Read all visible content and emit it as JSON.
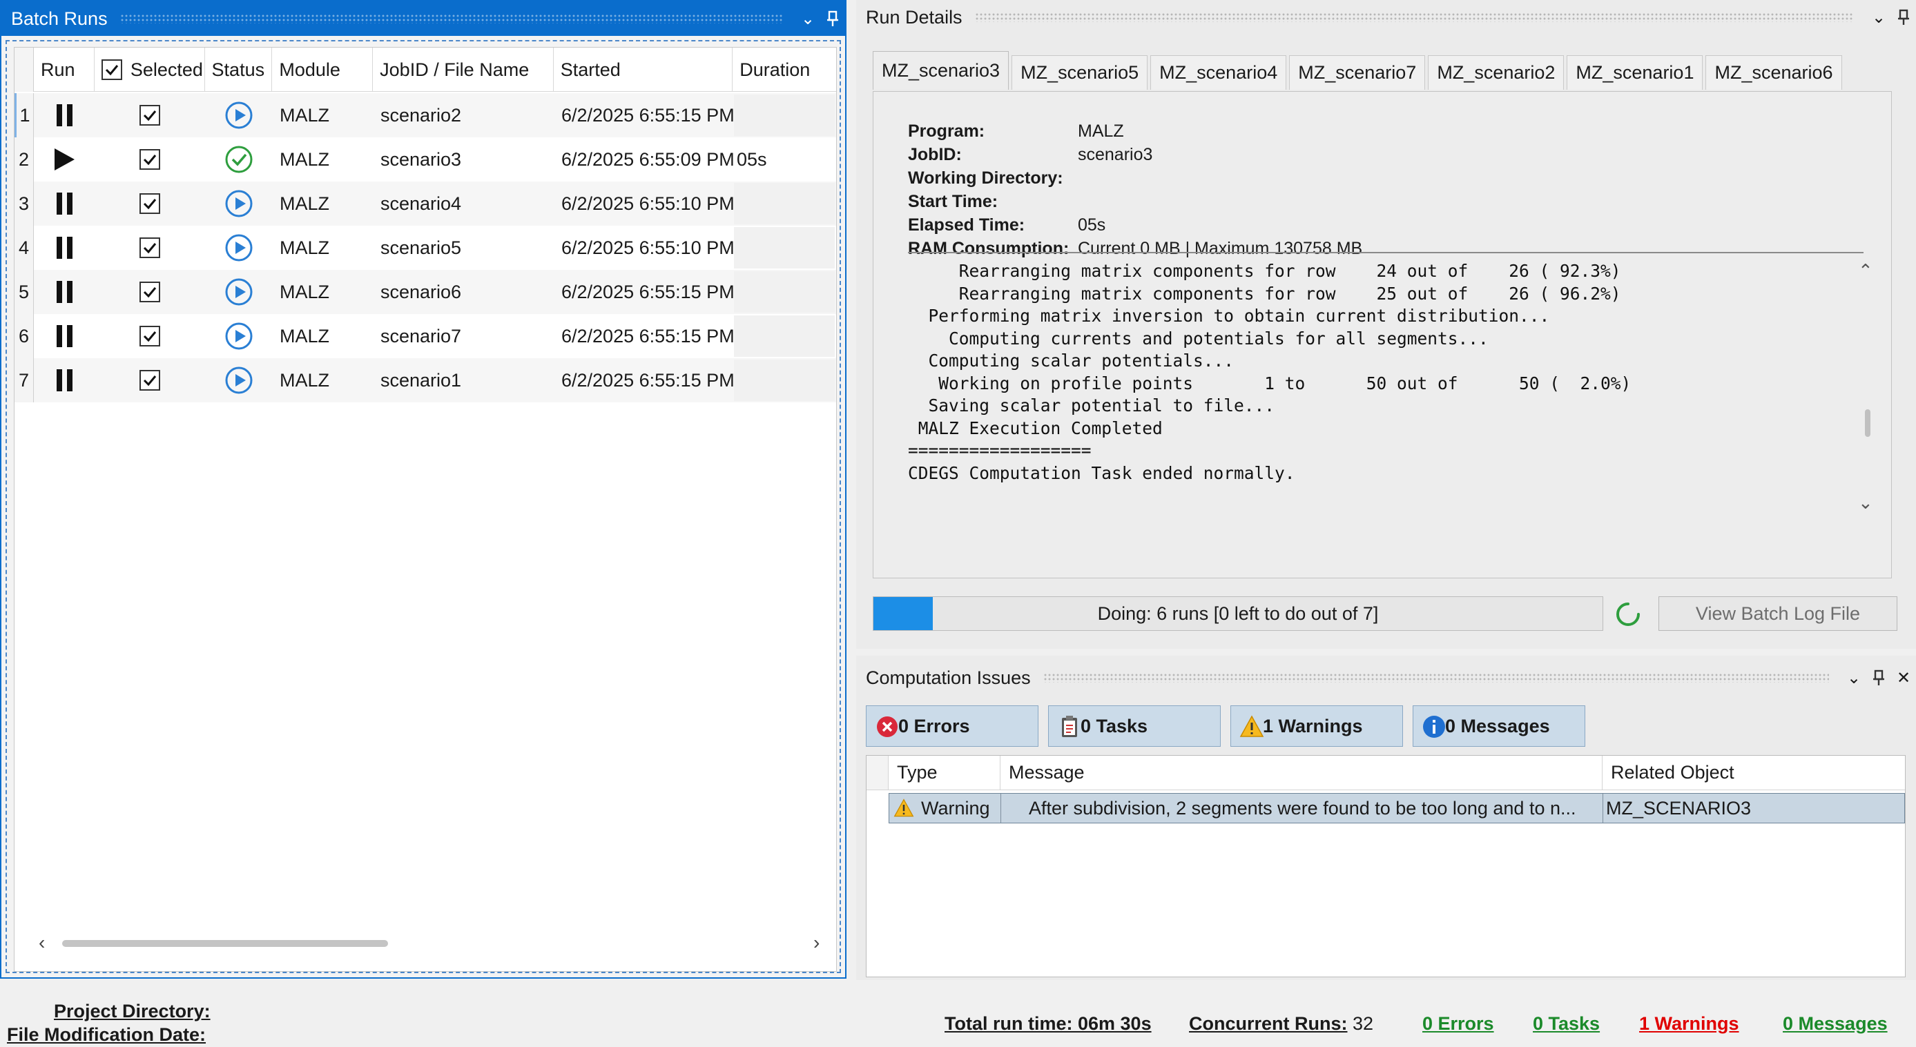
{
  "batch": {
    "title": "Batch Runs",
    "columns": {
      "run": "Run",
      "selected": "Selected",
      "status": "Status",
      "module": "Module",
      "jobid": "JobID / File Name",
      "started": "Started",
      "duration": "Duration"
    },
    "rows": [
      {
        "idx": "1",
        "run_state": "pause",
        "module": "MALZ",
        "job": "scenario2",
        "started": "6/2/2025 6:55:15 PM",
        "status": "running",
        "duration": ""
      },
      {
        "idx": "2",
        "run_state": "play",
        "module": "MALZ",
        "job": "scenario3",
        "started": "6/2/2025 6:55:09 PM",
        "status": "done",
        "duration": "05s"
      },
      {
        "idx": "3",
        "run_state": "pause",
        "module": "MALZ",
        "job": "scenario4",
        "started": "6/2/2025 6:55:10 PM",
        "status": "running",
        "duration": ""
      },
      {
        "idx": "4",
        "run_state": "pause",
        "module": "MALZ",
        "job": "scenario5",
        "started": "6/2/2025 6:55:10 PM",
        "status": "running",
        "duration": ""
      },
      {
        "idx": "5",
        "run_state": "pause",
        "module": "MALZ",
        "job": "scenario6",
        "started": "6/2/2025 6:55:15 PM",
        "status": "running",
        "duration": ""
      },
      {
        "idx": "6",
        "run_state": "pause",
        "module": "MALZ",
        "job": "scenario7",
        "started": "6/2/2025 6:55:15 PM",
        "status": "running",
        "duration": ""
      },
      {
        "idx": "7",
        "run_state": "pause",
        "module": "MALZ",
        "job": "scenario1",
        "started": "6/2/2025 6:55:15 PM",
        "status": "running",
        "duration": ""
      }
    ]
  },
  "details": {
    "title": "Run Details",
    "tabs": [
      "MZ_scenario3",
      "MZ_scenario5",
      "MZ_scenario4",
      "MZ_scenario7",
      "MZ_scenario2",
      "MZ_scenario1",
      "MZ_scenario6"
    ],
    "info": {
      "program_label": "Program:",
      "program": "MALZ",
      "jobid_label": "JobID:",
      "jobid": "scenario3",
      "workdir_label": "Working Directory:",
      "workdir": "",
      "start_label": "Start Time:",
      "start": "",
      "elapsed_label": "Elapsed Time:",
      "elapsed": "05s",
      "ram_label": "RAM Consumption:",
      "ram": "Current 0 MB | Maximum 130758 MB"
    },
    "log_lines": [
      "     Rearranging matrix components for row    24 out of    26 ( 92.3%)",
      "     Rearranging matrix components for row    25 out of    26 ( 96.2%)",
      "  Performing matrix inversion to obtain current distribution...",
      "    Computing currents and potentials for all segments...",
      "  Computing scalar potentials...",
      "   Working on profile points       1 to      50 out of      50 (  2.0%)",
      "  Saving scalar potential to file...",
      " MALZ Execution Completed",
      "==================",
      "CDEGS Computation Task ended normally."
    ],
    "progress_text": "Doing: 6 runs [0 left to do out of 7]",
    "progress_fraction": 0.081,
    "view_log": "View Batch Log File"
  },
  "issues": {
    "title": "Computation Issues",
    "buttons": {
      "errors": "0 Errors",
      "tasks": "0 Tasks",
      "warnings": "1 Warnings",
      "messages": "0 Messages"
    },
    "columns": {
      "type": "Type",
      "message": "Message",
      "related": "Related Object"
    },
    "rows": [
      {
        "type": "Warning",
        "message": "After subdivision, 2 segments were found to be too long and to n...",
        "related": "MZ_SCENARIO3"
      }
    ]
  },
  "status_bar": {
    "project_dir": "Project Directory:",
    "file_mod": "File Modification Date:",
    "total_run_time": "Total run time: 06m 30s",
    "concurrent_label": "Concurrent Runs:",
    "concurrent_value": "32",
    "errors": "0 Errors",
    "tasks": "0 Tasks",
    "warnings": "1 Warnings",
    "messages": "0 Messages"
  },
  "colors": {
    "accent": "#0a6dcc",
    "running": "#2a7fd4",
    "done": "#2e9e3e",
    "ok": "#1b8a2a",
    "warn": "#e00000"
  }
}
